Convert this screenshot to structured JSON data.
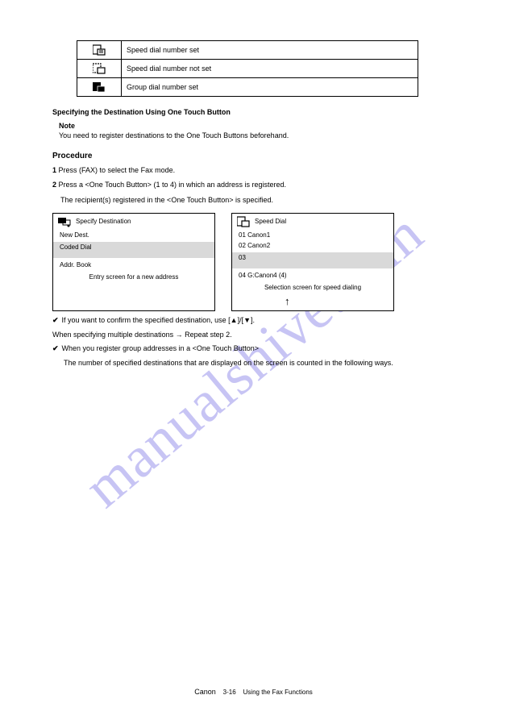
{
  "table": {
    "row1": "Speed dial number set",
    "row2": "Speed dial number not set",
    "row3": "Group dial number set"
  },
  "heading": "Specifying the Destination Using One Touch Button",
  "note_lead": "Note",
  "note_body": "You need to register destinations to the One Touch Buttons beforehand.",
  "procedure": "Procedure",
  "step1": "Press (FAX) to select the Fax mode.",
  "step2": "Press a <One Touch Button> (1 to 4) in which an address is registered.",
  "step3": "The recipient(s) registered in the <One Touch Button> is specified.",
  "boxL": {
    "hdr": "Specify Destination",
    "a": "New Dest.",
    "b": "Coded Dial",
    "c": "Addr. Book"
  },
  "boxR": {
    "hdr": "Speed Dial",
    "a": "01 Canon1",
    "b": "02 Canon2",
    "c": "03",
    "d": "04 G:Canon4 (4)"
  },
  "boxL_caption": "Entry screen for a new address",
  "boxR_caption": "Selection screen for speed dialing",
  "tip": "If you want to confirm the specified destination, use [▲]/[▼].",
  "skip1": "When specifying multiple destinations → Repeat step 2.",
  "skip2a": "When you register group addresses in a <One Touch Button>",
  "skip2b": "The number of specified destinations that are displayed on the screen is counted in the following ways.",
  "footer": {
    "brand": "Canon",
    "page": "3-16",
    "title": "Using the Fax Functions"
  }
}
